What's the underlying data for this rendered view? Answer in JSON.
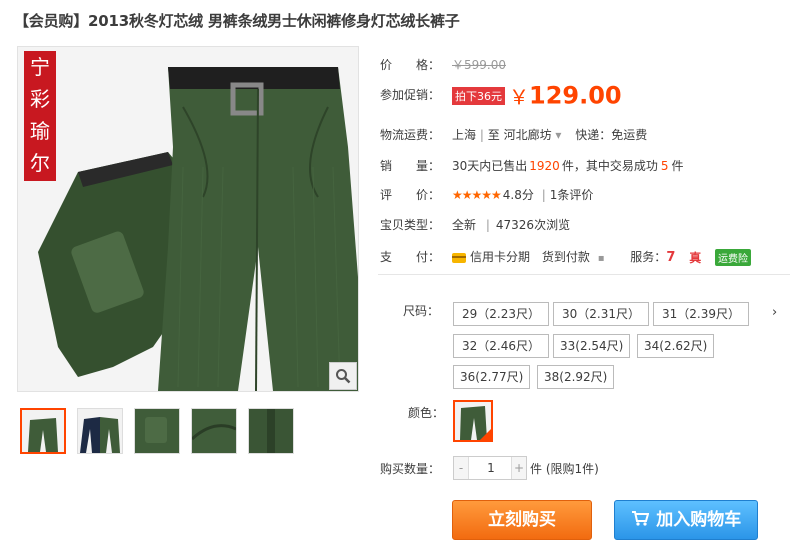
{
  "product": {
    "title": "【会员购】2013秋冬灯芯绒 男裤条绒男士休闲裤修身灯芯绒长裤子",
    "brand_stamp": "宁彩瑜尔"
  },
  "price": {
    "label": "价　　格：",
    "original": "￥599.00",
    "promo_label": "参加促销：",
    "promo_tag": "拍下36元",
    "currency": "￥",
    "promo_price": "129.00"
  },
  "shipping": {
    "label": "物流运费：",
    "from": "上海",
    "sep": "|",
    "to_prefix": "至",
    "to": "河北廊坊",
    "dropdown": "▾",
    "delivery": "快递：免运费"
  },
  "sales": {
    "label": "销　　量：",
    "text_prefix": "30天内已售出",
    "count": "1920",
    "text_mid": "件，其中交易成功",
    "success": "5",
    "unit": "件"
  },
  "rating": {
    "label": "评　　价：",
    "stars": "★★★★★",
    "score": "4.8分",
    "sep": "|",
    "reviews": "1条评价"
  },
  "item_type": {
    "label": "宝贝类型：",
    "condition": "全新",
    "sep": "|",
    "views": "47326次浏览"
  },
  "payment": {
    "label": "支　　付：",
    "installment": "信用卡分期",
    "cod": "货到付款",
    "services_label": "服务：",
    "service_7": "7",
    "service_real": "真",
    "insurance": "运费险"
  },
  "sku": {
    "size_label": "尺码：",
    "more": "›",
    "sizes": [
      "29（2.23尺）",
      "30（2.31尺）",
      "31（2.39尺）",
      "32（2.46尺）",
      "33(2.54尺)",
      "34(2.62尺)",
      "36(2.77尺)",
      "38(2.92尺)"
    ],
    "color_label": "颜色：",
    "qty_label": "购买数量：",
    "qty_minus": "-",
    "qty_plus": "+",
    "qty_value": "1",
    "qty_note": "件 (限购1件)"
  },
  "actions": {
    "buy_now": "立刻购买",
    "add_cart": "加入购物车"
  },
  "colors": {
    "accent": "#ff4400",
    "buy": "#f26b10",
    "cart": "#2b95e8",
    "pants": "#3d5a3a"
  }
}
